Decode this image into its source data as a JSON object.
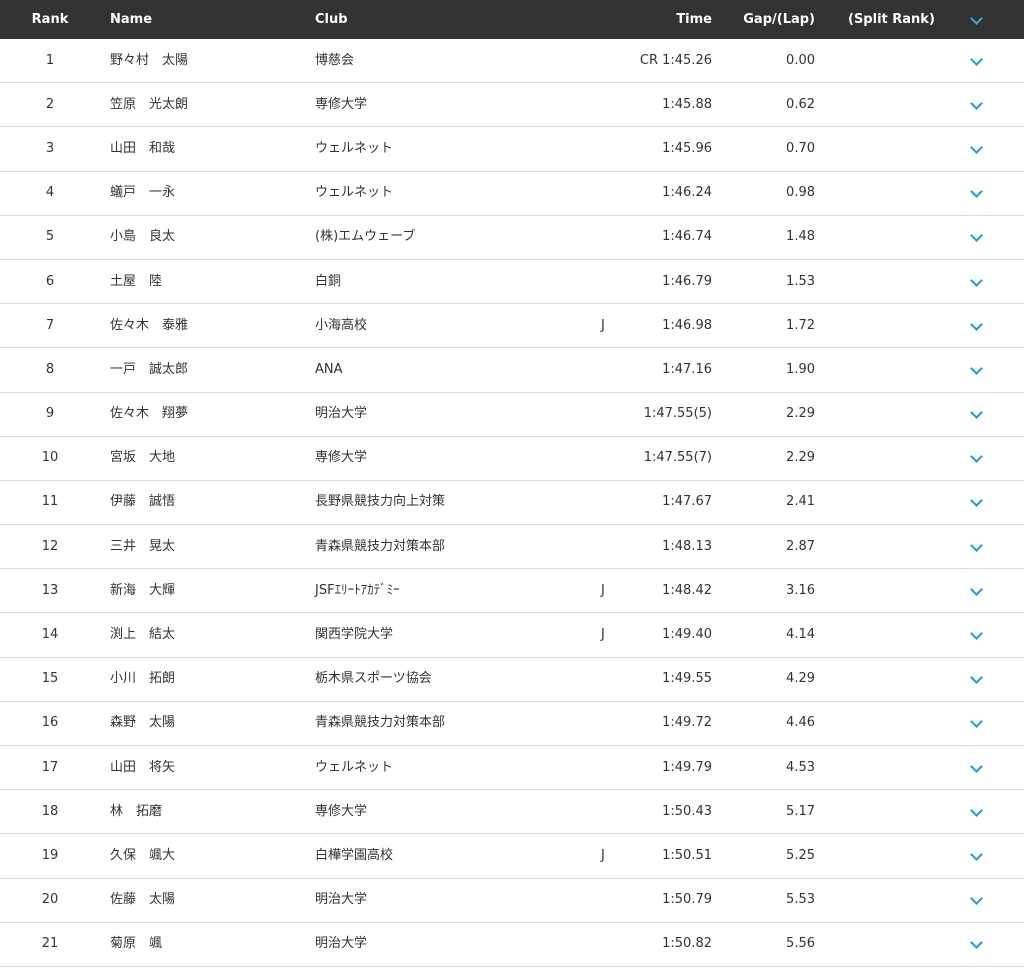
{
  "header": {
    "rank": "Rank",
    "name": "Name",
    "club": "Club",
    "time": "Time",
    "gap": "Gap/(Lap)",
    "split": "(Split Rank)",
    "toggle_icon": "chevron-down-icon"
  },
  "colors": {
    "header_bg": "#333333",
    "chevron": "#1a9bd7",
    "divider": "#d9d9d9"
  },
  "rows": [
    {
      "rank": "1",
      "name": "野々村　太陽",
      "club": "博慈会",
      "flag": "",
      "time": "CR 1:45.26",
      "gap": "0.00"
    },
    {
      "rank": "2",
      "name": "笠原　光太朗",
      "club": "専修大学",
      "flag": "",
      "time": "1:45.88",
      "gap": "0.62"
    },
    {
      "rank": "3",
      "name": "山田　和哉",
      "club": "ウェルネット",
      "flag": "",
      "time": "1:45.96",
      "gap": "0.70"
    },
    {
      "rank": "4",
      "name": "蟻戸　一永",
      "club": "ウェルネット",
      "flag": "",
      "time": "1:46.24",
      "gap": "0.98"
    },
    {
      "rank": "5",
      "name": "小島　良太",
      "club": "(株)エムウェーブ",
      "flag": "",
      "time": "1:46.74",
      "gap": "1.48"
    },
    {
      "rank": "6",
      "name": "土屋　陸",
      "club": "白銅",
      "flag": "",
      "time": "1:46.79",
      "gap": "1.53"
    },
    {
      "rank": "7",
      "name": "佐々木　泰雅",
      "club": "小海高校",
      "flag": "J",
      "time": "1:46.98",
      "gap": "1.72"
    },
    {
      "rank": "8",
      "name": "一戸　誠太郎",
      "club": "ANA",
      "flag": "",
      "time": "1:47.16",
      "gap": "1.90"
    },
    {
      "rank": "9",
      "name": "佐々木　翔夢",
      "club": "明治大学",
      "flag": "",
      "time": "1:47.55(5)",
      "gap": "2.29"
    },
    {
      "rank": "10",
      "name": "宮坂　大地",
      "club": "専修大学",
      "flag": "",
      "time": "1:47.55(7)",
      "gap": "2.29"
    },
    {
      "rank": "11",
      "name": "伊藤　誠悟",
      "club": "長野県競技力向上対策",
      "flag": "",
      "time": "1:47.67",
      "gap": "2.41"
    },
    {
      "rank": "12",
      "name": "三井　晃太",
      "club": "青森県競技力対策本部",
      "flag": "",
      "time": "1:48.13",
      "gap": "2.87"
    },
    {
      "rank": "13",
      "name": "新海　大輝",
      "club": "JSFｴﾘｰﾄｱｶﾃﾞﾐｰ",
      "flag": "J",
      "time": "1:48.42",
      "gap": "3.16"
    },
    {
      "rank": "14",
      "name": "渕上　結太",
      "club": "関西学院大学",
      "flag": "J",
      "time": "1:49.40",
      "gap": "4.14"
    },
    {
      "rank": "15",
      "name": "小川　拓朗",
      "club": "栃木県スポーツ協会",
      "flag": "",
      "time": "1:49.55",
      "gap": "4.29"
    },
    {
      "rank": "16",
      "name": "森野　太陽",
      "club": "青森県競技力対策本部",
      "flag": "",
      "time": "1:49.72",
      "gap": "4.46"
    },
    {
      "rank": "17",
      "name": "山田　将矢",
      "club": "ウェルネット",
      "flag": "",
      "time": "1:49.79",
      "gap": "4.53"
    },
    {
      "rank": "18",
      "name": "林　拓磨",
      "club": "専修大学",
      "flag": "",
      "time": "1:50.43",
      "gap": "5.17"
    },
    {
      "rank": "19",
      "name": "久保　颯大",
      "club": "白樺学園高校",
      "flag": "J",
      "time": "1:50.51",
      "gap": "5.25"
    },
    {
      "rank": "20",
      "name": "佐藤　太陽",
      "club": "明治大学",
      "flag": "",
      "time": "1:50.79",
      "gap": "5.53"
    },
    {
      "rank": "21",
      "name": "菊原　颯",
      "club": "明治大学",
      "flag": "",
      "time": "1:50.82",
      "gap": "5.56"
    }
  ]
}
